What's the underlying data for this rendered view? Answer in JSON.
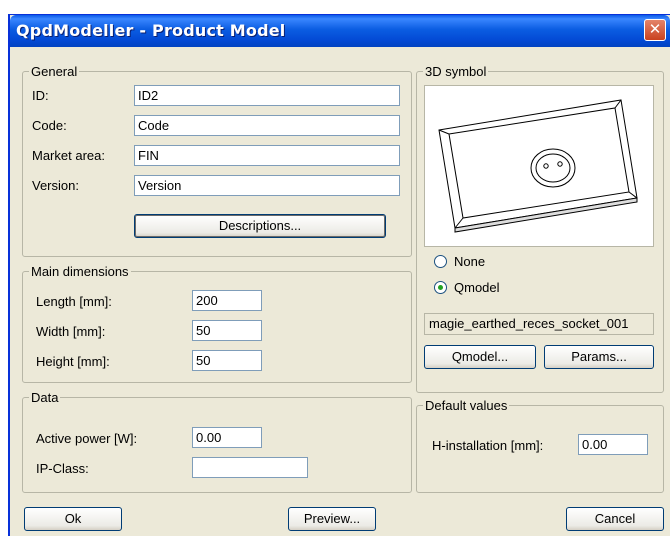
{
  "window": {
    "title": "QpdModeller - Product Model",
    "close_glyph": "✕"
  },
  "general": {
    "legend": "General",
    "id_label": "ID:",
    "id_value": "ID2",
    "code_label": "Code:",
    "code_value": "Code",
    "market_label": "Market area:",
    "market_value": "FIN",
    "version_label": "Version:",
    "version_value": "Version",
    "descriptions_button": "Descriptions..."
  },
  "dimensions": {
    "legend": "Main dimensions",
    "length_label": "Length [mm]:",
    "length_value": "200",
    "width_label": "Width [mm]:",
    "width_value": "50",
    "height_label": "Height [mm]:",
    "height_value": "50"
  },
  "data": {
    "legend": "Data",
    "power_label": "Active power [W]:",
    "power_value": "0.00",
    "ip_label": "IP-Class:",
    "ip_value": ""
  },
  "symbol": {
    "legend": "3D symbol",
    "radio_none_label": "None",
    "radio_qmodel_label": "Qmodel",
    "selected": "Qmodel",
    "model_name": "magie_earthed_reces_socket_001",
    "qmodel_button": "Qmodel...",
    "params_button": "Params..."
  },
  "defaults": {
    "legend": "Default values",
    "hinst_label": "H-installation [mm]:",
    "hinst_value": "0.00"
  },
  "footer": {
    "ok_button": "Ok",
    "preview_button": "Preview...",
    "cancel_button": "Cancel"
  }
}
